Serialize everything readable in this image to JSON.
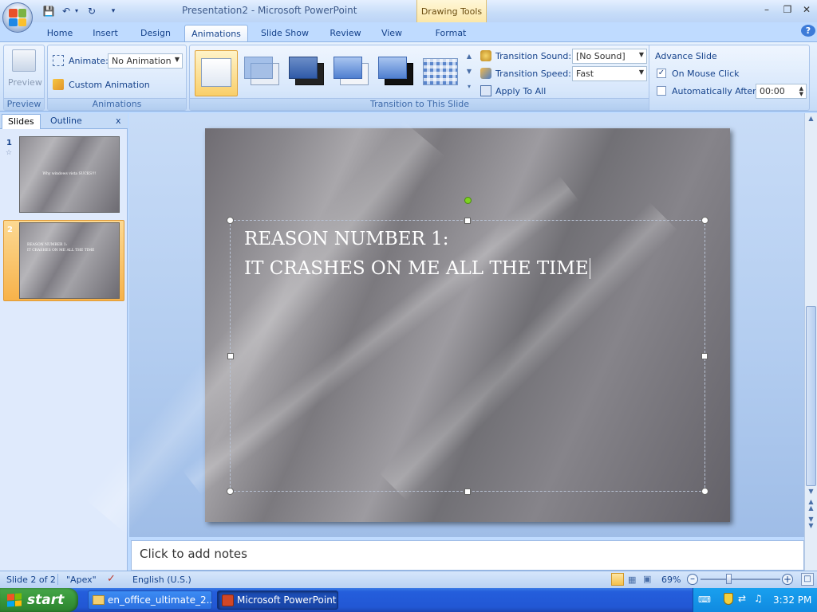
{
  "window": {
    "title": "Presentation2 - Microsoft PowerPoint",
    "contextual_tab_group": "Drawing Tools",
    "minimize": "–",
    "restore": "❐",
    "close": "✕",
    "help": "?"
  },
  "tabs": [
    {
      "label": "Home"
    },
    {
      "label": "Insert"
    },
    {
      "label": "Design"
    },
    {
      "label": "Animations",
      "active": true
    },
    {
      "label": "Slide Show"
    },
    {
      "label": "Review"
    },
    {
      "label": "View"
    },
    {
      "label": "Format"
    }
  ],
  "ribbon": {
    "preview_group": {
      "button_label": "Preview",
      "group_label": "Preview"
    },
    "animations_group": {
      "animate_label": "Animate:",
      "animate_value": "No Animation",
      "custom_animation": "Custom Animation",
      "group_label": "Animations"
    },
    "transition_group": {
      "sound_label": "Transition Sound:",
      "sound_value": "[No Sound]",
      "speed_label": "Transition Speed:",
      "speed_value": "Fast",
      "apply_all": "Apply To All",
      "group_label": "Transition to This Slide"
    },
    "advance_group": {
      "title": "Advance Slide",
      "on_mouse_click": "On Mouse Click",
      "on_mouse_click_checked": true,
      "auto_after": "Automatically After:",
      "auto_after_checked": false,
      "auto_time": "00:00"
    }
  },
  "left_pane": {
    "tabs": [
      "Slides",
      "Outline"
    ],
    "close": "x",
    "slides": [
      {
        "number": "1",
        "text": "Why windows vista SUCKS!!!"
      },
      {
        "number": "2",
        "text_line1": "REASON NUMBER 1:",
        "text_line2": "IT CRASHES ON ME ALL THE TIME",
        "selected": true
      }
    ]
  },
  "slide": {
    "line1": "REASON NUMBER 1:",
    "line2": "IT CRASHES ON ME ALL THE TIME"
  },
  "notes": {
    "placeholder": "Click to add notes"
  },
  "statusbar": {
    "slide_info": "Slide 2 of 2",
    "theme": "\"Apex\"",
    "language": "English (U.S.)",
    "zoom": "69%",
    "zoom_fraction": 0.69
  },
  "taskbar": {
    "start": "start",
    "items": [
      {
        "label": "en_office_ultimate_2..."
      },
      {
        "label": "Microsoft PowerPoint ..."
      }
    ],
    "clock": "3:32 PM"
  },
  "colors": {
    "accent": "#15428b",
    "ribbon": "#d2e4fb",
    "selected_slide": "#f8b64c",
    "taskbar": "#245edc",
    "start": "#3a9a3c"
  }
}
